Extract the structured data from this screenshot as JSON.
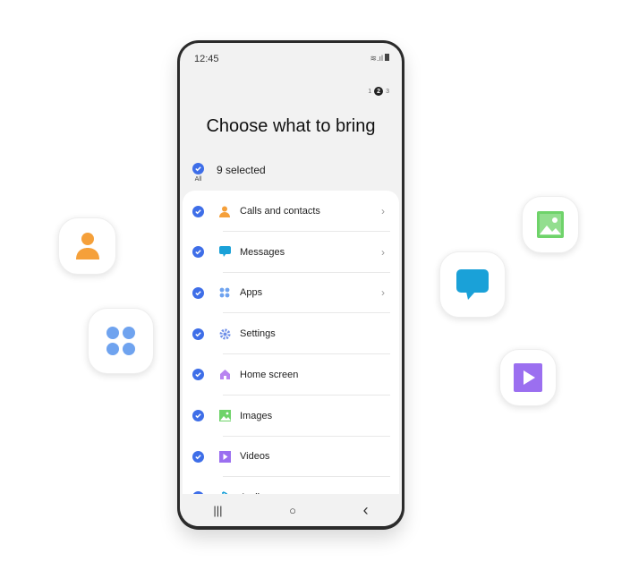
{
  "status": {
    "time": "12:45"
  },
  "pager": {
    "steps": [
      "1",
      "2",
      "3"
    ],
    "current": "2"
  },
  "title": "Choose what to bring",
  "select_all": {
    "label": "All",
    "count_text": "9 selected"
  },
  "items": [
    {
      "label": "Calls and contacts",
      "icon": "person-icon",
      "color": "#f5a03a",
      "chevron": true
    },
    {
      "label": "Messages",
      "icon": "message-icon",
      "color": "#1aa1d8",
      "chevron": true
    },
    {
      "label": "Apps",
      "icon": "apps-icon",
      "color": "#6fa3ef",
      "chevron": true
    },
    {
      "label": "Settings",
      "icon": "gear-icon",
      "color": "#6f8fe8",
      "chevron": false
    },
    {
      "label": "Home screen",
      "icon": "home-icon",
      "color": "#b884f0",
      "chevron": false
    },
    {
      "label": "Images",
      "icon": "image-icon",
      "color": "#6fd36a",
      "chevron": false
    },
    {
      "label": "Videos",
      "icon": "video-icon",
      "color": "#9b6ff0",
      "chevron": false
    },
    {
      "label": "Audio",
      "icon": "music-icon",
      "color": "#1aa1d8",
      "chevron": false
    }
  ],
  "nav": {
    "recents": "|||",
    "home": "○",
    "back": "‹"
  }
}
